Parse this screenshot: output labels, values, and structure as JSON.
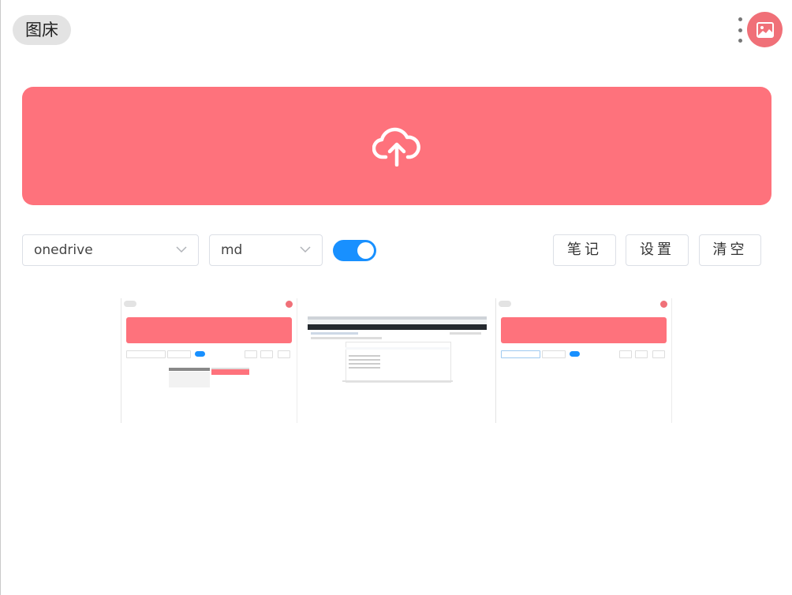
{
  "header": {
    "title": "图床",
    "more_icon": "more-vertical-icon",
    "avatar_icon": "image-icon"
  },
  "upload": {
    "icon": "cloud-upload-icon",
    "color": "#fe727c"
  },
  "controls": {
    "storage_select": {
      "value": "onedrive"
    },
    "format_select": {
      "value": "md"
    },
    "auto_toggle": {
      "on": true,
      "color": "#1890ff"
    },
    "buttons": {
      "notes": "笔记",
      "settings": "设置",
      "clear": "清空"
    }
  },
  "gallery": {
    "thumbnails": [
      {
        "kind": "app-screenshot"
      },
      {
        "kind": "browser-screenshot"
      },
      {
        "kind": "app-screenshot"
      }
    ]
  }
}
